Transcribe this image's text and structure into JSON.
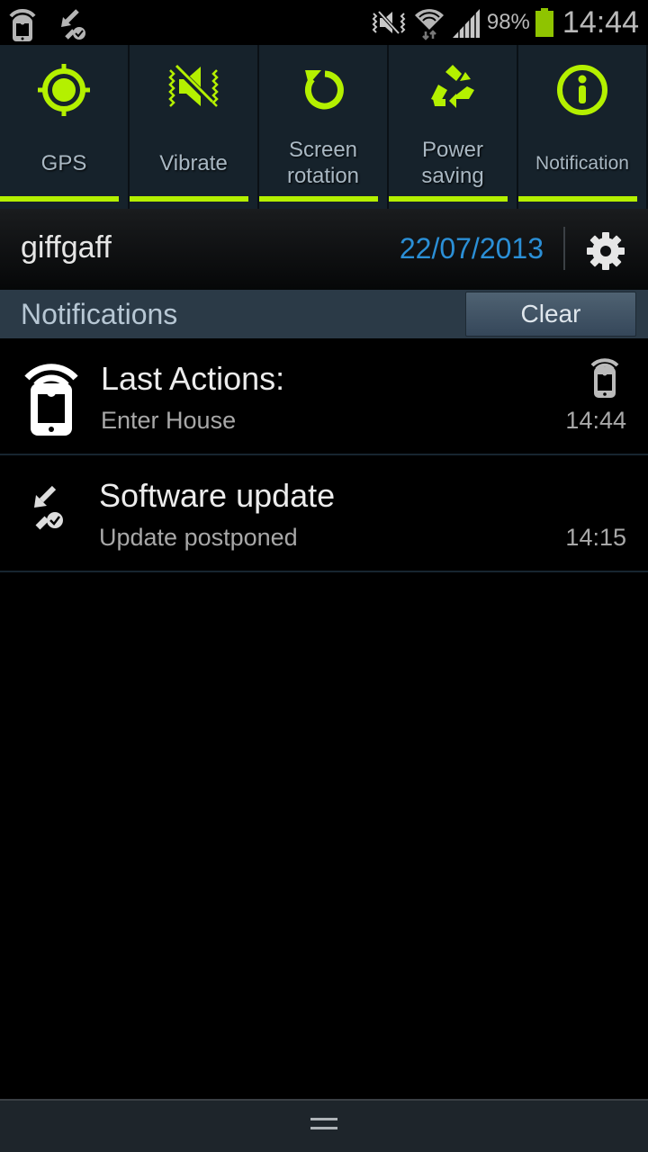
{
  "status_bar": {
    "left_icons": [
      "remote-phone-icon",
      "software-update-icon"
    ],
    "right_icons": [
      "mute-vibrate-icon",
      "wifi-icon",
      "signal-icon"
    ],
    "battery_percent": "98%",
    "battery_level": 0.98,
    "clock": "14:44",
    "battery_color": "#8fc400"
  },
  "quick_toggles": [
    {
      "label": "GPS",
      "icon": "gps-icon",
      "enabled": true
    },
    {
      "label": "Vibrate",
      "icon": "vibrate-icon",
      "enabled": true
    },
    {
      "label": "Screen rotation",
      "icon": "rotation-icon",
      "enabled": true
    },
    {
      "label": "Power saving",
      "icon": "recycle-icon",
      "enabled": true
    },
    {
      "label": "Notification",
      "icon": "info-icon",
      "enabled": true
    }
  ],
  "accent_color": "#b4f000",
  "operator_bar": {
    "operator": "giffgaff",
    "date": "22/07/2013",
    "date_color": "#2b8fd6"
  },
  "notifications_header": {
    "title": "Notifications",
    "clear_label": "Clear"
  },
  "notifications": [
    {
      "title": "Last Actions:",
      "subtitle": "Enter House",
      "time": "14:44",
      "icon": "remote-phone-icon"
    },
    {
      "title": "Software update",
      "subtitle": "Update postponed",
      "time": "14:15",
      "icon": "software-update-icon"
    }
  ]
}
